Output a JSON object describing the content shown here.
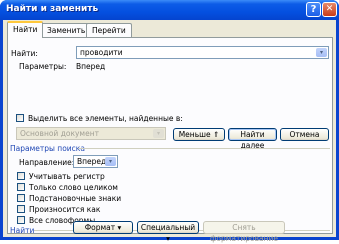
{
  "window": {
    "title": "Найти и заменить",
    "help_glyph": "?",
    "close_glyph": "✕"
  },
  "tabs": [
    {
      "label": "Найти"
    },
    {
      "label": "Заменить"
    },
    {
      "label": "Перейти"
    }
  ],
  "find": {
    "label": "Найти:",
    "value": "проводити",
    "params_label": "Параметры:",
    "params_value": "Вперед"
  },
  "highlight": {
    "checkbox_label": "Выделить все элементы, найденные в:",
    "scope_value": "Основной документ"
  },
  "buttons": {
    "less": "Меньше",
    "less_glyph": "⇑",
    "find_next": "Найти далее",
    "cancel": "Отмена",
    "format": "Формат",
    "special": "Специальный",
    "clear_format": "Снять форматирование",
    "dropdown_glyph": "▾"
  },
  "search_params": {
    "title": "Параметры поиска",
    "direction_label": "Направление:",
    "direction_value": "Вперед",
    "options": [
      "Учитывать регистр",
      "Только слово целиком",
      "Подстановочные знаки",
      "Произносится как",
      "Все словоформы"
    ]
  },
  "footer_group": {
    "title": "Найти"
  }
}
